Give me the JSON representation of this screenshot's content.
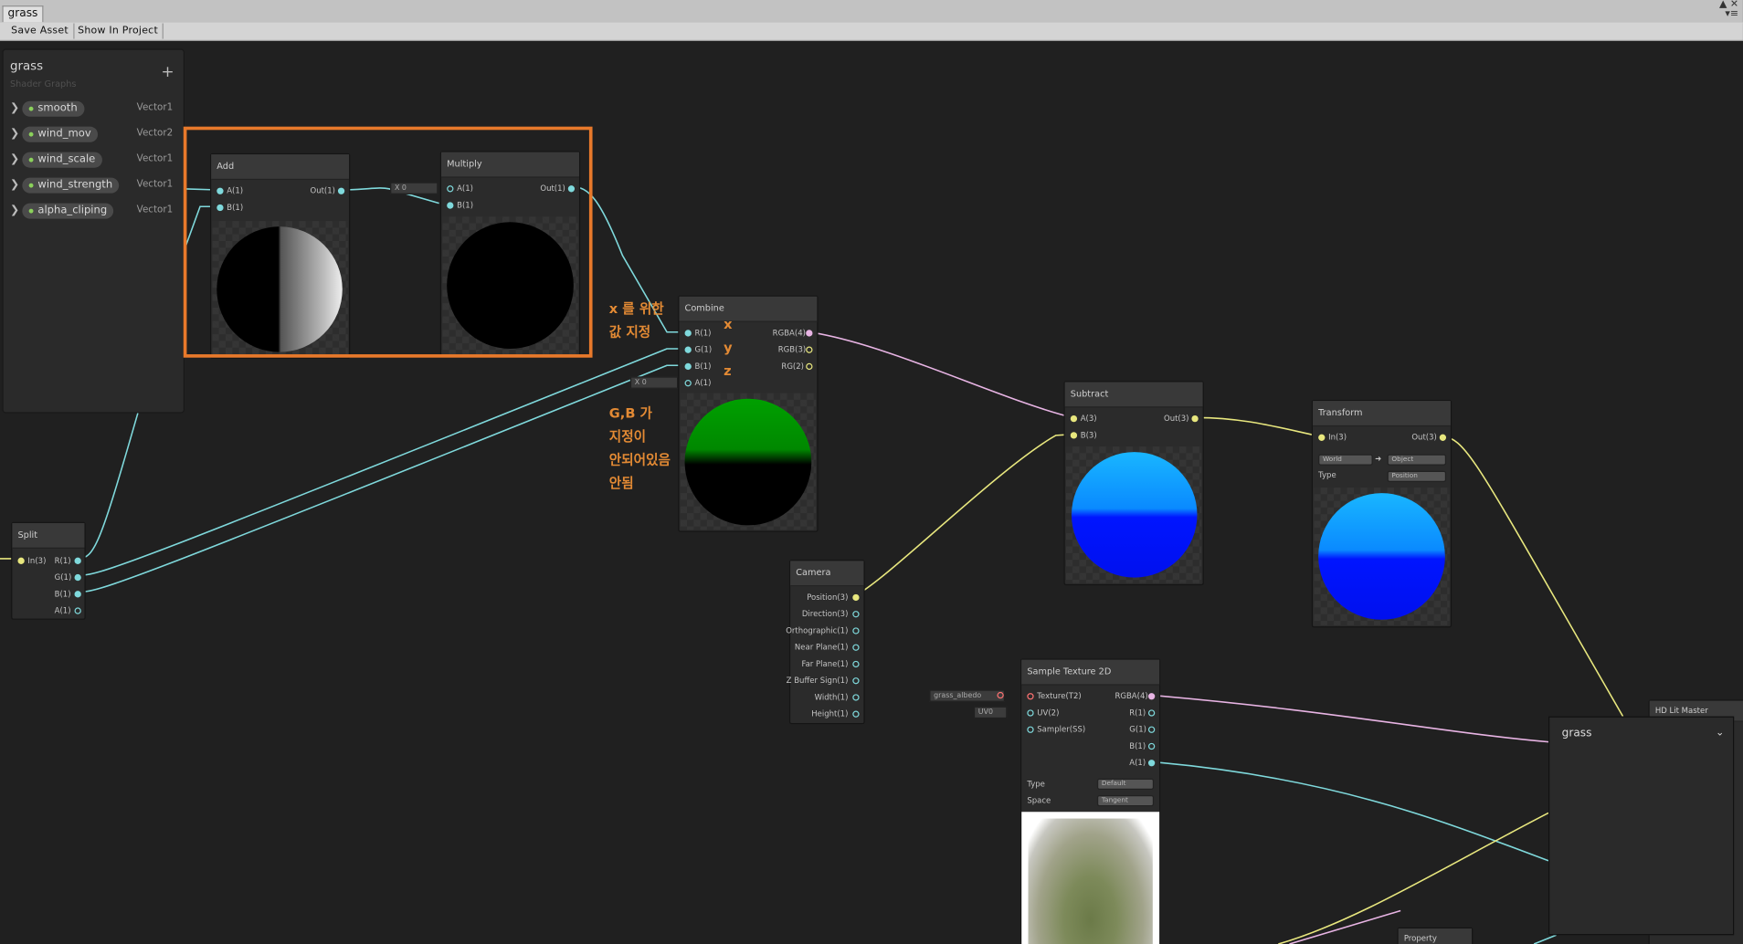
{
  "window": {
    "tab_label": "grass",
    "controls": "▲ ✕\n▾≡"
  },
  "toolbar": {
    "save_asset": "Save Asset",
    "show_in_project": "Show In Project"
  },
  "blackboard": {
    "title": "grass",
    "subtitle": "Shader Graphs",
    "add": "+",
    "properties": [
      {
        "name": "smooth",
        "type": "Vector1"
      },
      {
        "name": "wind_mov",
        "type": "Vector2"
      },
      {
        "name": "wind_scale",
        "type": "Vector1"
      },
      {
        "name": "wind_strength",
        "type": "Vector1"
      },
      {
        "name": "alpha_cliping",
        "type": "Vector1"
      }
    ]
  },
  "nodes": {
    "add": {
      "title": "Add",
      "in_a": "A(1)",
      "in_b": "B(1)",
      "out": "Out(1)"
    },
    "multiply": {
      "title": "Multiply",
      "in_a": "A(1)",
      "in_b": "B(1)",
      "out": "Out(1)",
      "default_x": "X 0"
    },
    "combine": {
      "title": "Combine",
      "in_r": "R(1)",
      "in_g": "G(1)",
      "in_b": "B(1)",
      "in_a": "A(1)",
      "out_rgba": "RGBA(4)",
      "out_rgb": "RGB(3)",
      "out_rg": "RG(2)",
      "default_x": "X 0"
    },
    "split": {
      "title": "Split",
      "in": "In(3)",
      "r": "R(1)",
      "g": "G(1)",
      "b": "B(1)",
      "a": "A(1)"
    },
    "subtract": {
      "title": "Subtract",
      "in_a": "A(3)",
      "in_b": "B(3)",
      "out": "Out(3)"
    },
    "transform": {
      "title": "Transform",
      "in": "In(3)",
      "out": "Out(3)",
      "from": "World",
      "to": "Object",
      "type_label": "Type",
      "type_value": "Position"
    },
    "camera": {
      "title": "Camera",
      "outputs": [
        "Position(3)",
        "Direction(3)",
        "Orthographic(1)",
        "Near Plane(1)",
        "Far Plane(1)",
        "Z Buffer Sign(1)",
        "Width(1)",
        "Height(1)"
      ]
    },
    "sample": {
      "title": "Sample Texture 2D",
      "in_tex": "Texture(T2)",
      "in_uv": "UV(2)",
      "in_sampler": "Sampler(SS)",
      "outputs": [
        "RGBA(4)",
        "R(1)",
        "G(1)",
        "B(1)",
        "A(1)"
      ],
      "type_label": "Type",
      "type_value": "Default",
      "space_label": "Space",
      "space_value": "Tangent",
      "texture_field": "grass_albedo",
      "uv_field": "UV0"
    },
    "master": {
      "title": "HD Lit Master"
    },
    "property": {
      "title": "Property"
    }
  },
  "master_panel": {
    "title": "grass"
  },
  "annotations": {
    "xy_note": "x 를 위한\n값 지정",
    "axis_x": "x",
    "axis_y": "y",
    "axis_z": "z",
    "gb_note": "G,B 가\n지정이\n안되어있음\n안됨"
  },
  "colors": {
    "annotation": "#e8792b",
    "wire_vector1": "#7fd9dc",
    "wire_vector3": "#e8e77e",
    "wire_vector4": "#e8b4e4"
  }
}
